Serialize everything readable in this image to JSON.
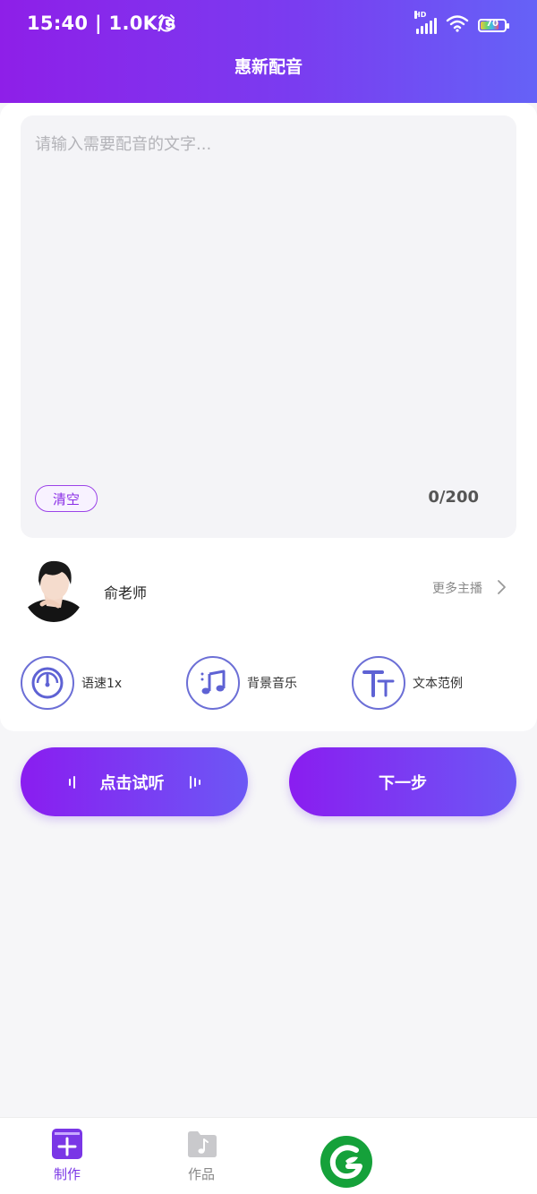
{
  "status_bar": {
    "time": "15:40 | 1.0K/s",
    "battery_level": "70"
  },
  "header": {
    "title": "惠新配音"
  },
  "editor": {
    "placeholder": "请输入需要配音的文字...",
    "clear_label": "清空",
    "char_count": "0/200"
  },
  "anchor": {
    "name": "俞老师",
    "more_label": "更多主播"
  },
  "options": [
    {
      "icon": "speed-gauge-icon",
      "label": "语速1x"
    },
    {
      "icon": "music-note-icon",
      "label": "背景音乐"
    },
    {
      "icon": "text-style-icon",
      "label": "文本范例"
    }
  ],
  "actions": {
    "preview_label": "点击试听",
    "next_label": "下一步"
  },
  "tabbar": {
    "tabs": [
      {
        "label": "制作",
        "active": true
      },
      {
        "label": "作品",
        "active": false
      }
    ]
  },
  "colors": {
    "accent_start": "#8e1fe8",
    "accent_end": "#6562f7",
    "logo_green": "#15a13a"
  }
}
